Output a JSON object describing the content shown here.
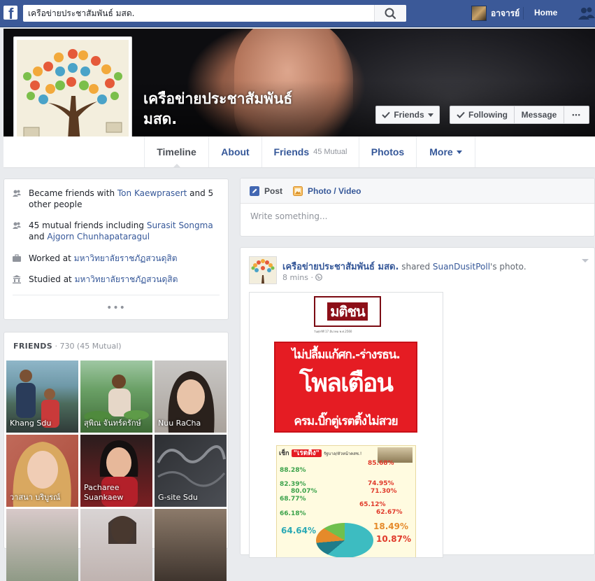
{
  "topbar": {
    "search_value": "เครือข่ายประชาสัมพันธ์ มสด.",
    "user_name": "อาจารย์",
    "home_label": "Home"
  },
  "page": {
    "name": "เครือข่ายประชาสัมพันธ์\nมสด.",
    "buttons": {
      "friends": "Friends",
      "following": "Following",
      "message": "Message",
      "more": "•••"
    }
  },
  "nav": {
    "timeline": "Timeline",
    "about": "About",
    "friends": "Friends",
    "friends_count": "45 Mutual",
    "photos": "Photos",
    "more": "More"
  },
  "intro": {
    "became_prefix": "Became friends with ",
    "became_link": "Ton Kaewprasert",
    "became_suffix": " and 5 other people",
    "mutual_prefix": "45 mutual friends including ",
    "mutual_link1": "Surasit Songma",
    "mutual_mid": " and ",
    "mutual_link2": "Ajgorn Chunhapataragul",
    "worked_prefix": "Worked at ",
    "worked_link": "มหาวิทยาลัยราชภัฏสวนดุสิต",
    "studied_prefix": "Studied at ",
    "studied_link": "มหาวิทยาลัยราชภัฏสวนดุสิต",
    "more": "•••"
  },
  "friends_box": {
    "title": "Friends",
    "count": " · 730 (45 Mutual)",
    "friends": [
      {
        "name": "Khang Sdu"
      },
      {
        "name": "สุพิณ จันทร์ดรักษ์"
      },
      {
        "name": "Nuu RaCha"
      },
      {
        "name": "วาสนา บริบูรณ์"
      },
      {
        "name": "Pacharee Suankaew"
      },
      {
        "name": "G-site Sdu"
      },
      {
        "name": ""
      },
      {
        "name": ""
      },
      {
        "name": ""
      }
    ]
  },
  "composer": {
    "post_tab": "Post",
    "photo_tab": "Photo / Video",
    "placeholder": "Write something..."
  },
  "post": {
    "author": "เครือข่ายประชาสัมพันธ์ มสด.",
    "action": " shared ",
    "source": "SuanDusitPoll",
    "suffix": "'s photo.",
    "time": "8 mins · ",
    "image": {
      "masthead": "มติชน",
      "dateline": "วันศุกร์ที่ 17 มีนาคม พ.ศ.2560",
      "headline1": "ไม่ปลื้มแก้ศก.-ร่างรธน.",
      "headline2": "โพลเตือน",
      "headline3": "ครม.บิ๊กตู่เรตติ้งไม่สวย",
      "info_title": "เช็ก",
      "info_rate": "\"เรตติ้ง\"",
      "info_sub": " รัฐบาล/หัวหน้าคสช.!",
      "left_stats": [
        "88.28%",
        "82.39%",
        "80.07%",
        "68.77%",
        "66.18%"
      ],
      "right_stats": [
        "85.68%",
        "74.95%",
        "71.30%",
        "65.12%",
        "62.67%"
      ],
      "big_left": "64.64%",
      "big_right1": "18.49%",
      "big_right2": "10.87%"
    }
  }
}
